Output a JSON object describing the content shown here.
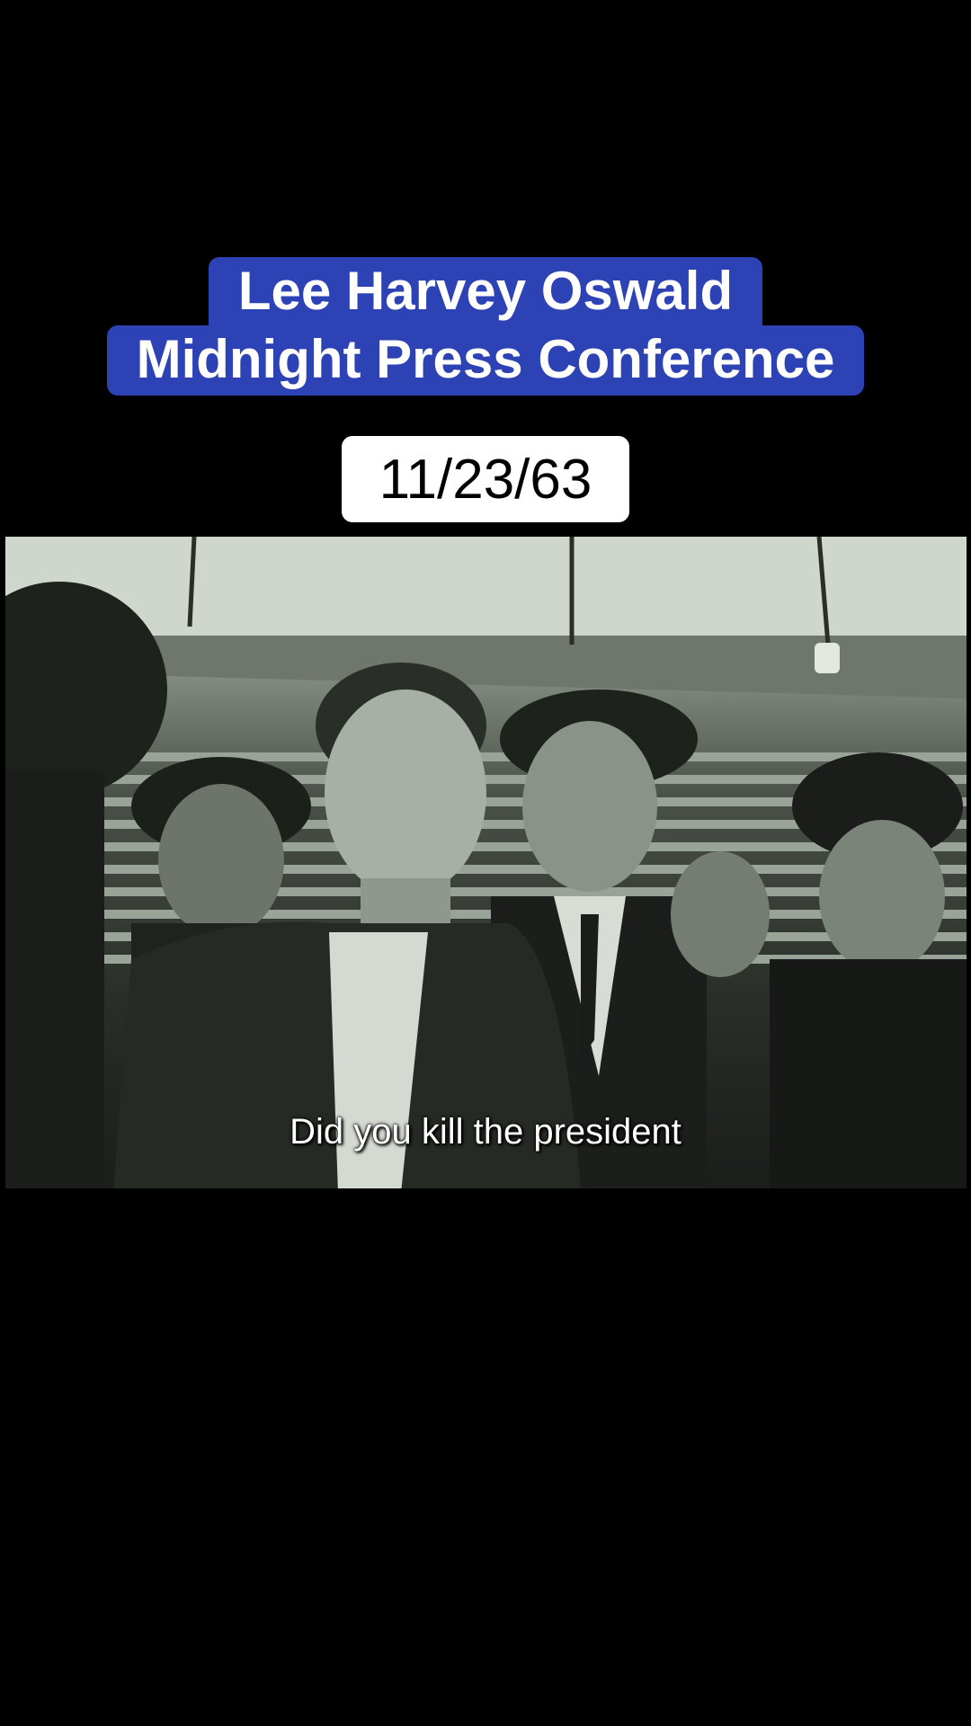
{
  "overlay": {
    "title_line_1": "Lee Harvey Oswald",
    "title_line_2": "Midnight Press Conference",
    "date": "11/23/63",
    "title_bg_color": "#2d42b4",
    "date_bg_color": "#ffffff"
  },
  "video": {
    "subtitle": "Did you kill the president"
  }
}
